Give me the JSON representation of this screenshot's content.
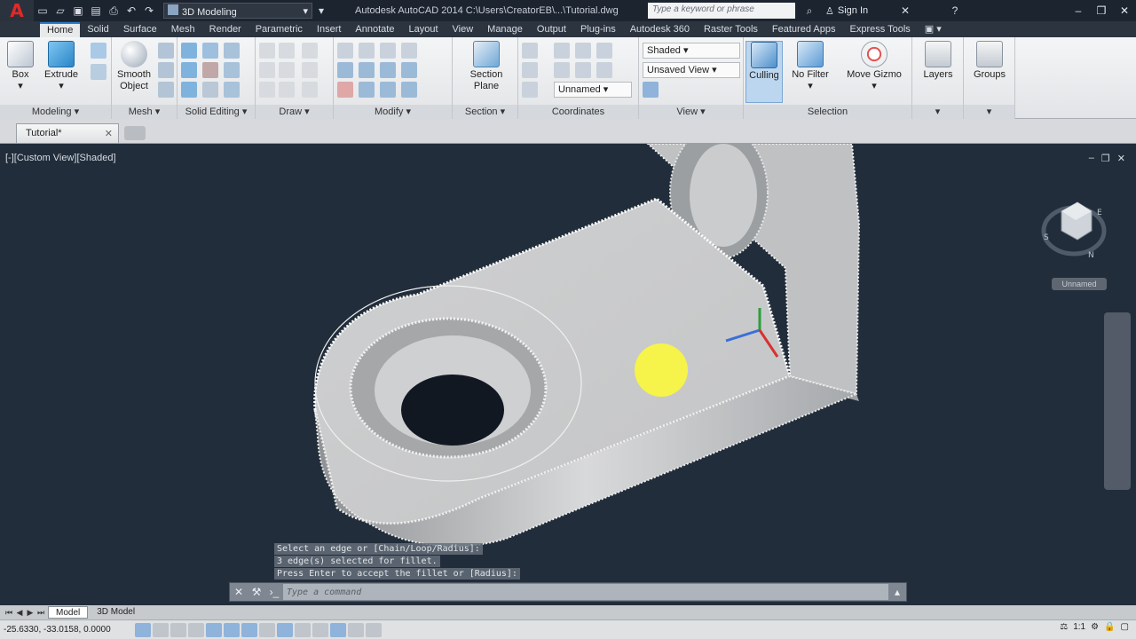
{
  "titlebar": {
    "workspace": "3D Modeling",
    "title": "Autodesk AutoCAD 2014    C:\\Users\\CreatorEB\\...\\Tutorial.dwg",
    "search_placeholder": "Type a keyword or phrase",
    "signin": "Sign In"
  },
  "ribbon": {
    "tabs": [
      "Home",
      "Solid",
      "Surface",
      "Mesh",
      "Render",
      "Parametric",
      "Insert",
      "Annotate",
      "Layout",
      "View",
      "Manage",
      "Output",
      "Plug-ins",
      "Autodesk 360",
      "Raster Tools",
      "Featured Apps",
      "Express Tools"
    ],
    "active_tab": "Home",
    "panels": {
      "modeling": "Modeling",
      "mesh": "Mesh",
      "solid_editing": "Solid Editing",
      "draw": "Draw",
      "modify": "Modify",
      "section": "Section",
      "coordinates": "Coordinates",
      "view": "View",
      "selection": "Selection"
    },
    "buttons": {
      "box": "Box",
      "extrude": "Extrude",
      "smooth_object": "Smooth Object",
      "section_plane": "Section Plane",
      "culling": "Culling",
      "no_filter": "No Filter",
      "move_gizmo": "Move Gizmo",
      "layers": "Layers",
      "groups": "Groups"
    },
    "view_style": "Shaded",
    "saved_view": "Unsaved View",
    "ucs_name": "Unnamed"
  },
  "filetabs": {
    "active": "Tutorial*"
  },
  "viewport": {
    "label": "[-][Custom View][Shaded]",
    "wcs": "Unnamed"
  },
  "command": {
    "history": [
      "Select an edge or [Chain/Loop/Radius]:",
      "3 edge(s) selected for fillet.",
      "Press Enter to accept the fillet or [Radius]:"
    ],
    "placeholder": "Type a command"
  },
  "layout": {
    "tabs": [
      "Model",
      "3D Model"
    ]
  },
  "status": {
    "coords": "-25.6330, -33.0158, 0.0000",
    "scale": "1:1"
  },
  "colors": {
    "accent": "#2b7bd2",
    "viewport_bg": "#212d3b",
    "app_red": "#e32828"
  }
}
